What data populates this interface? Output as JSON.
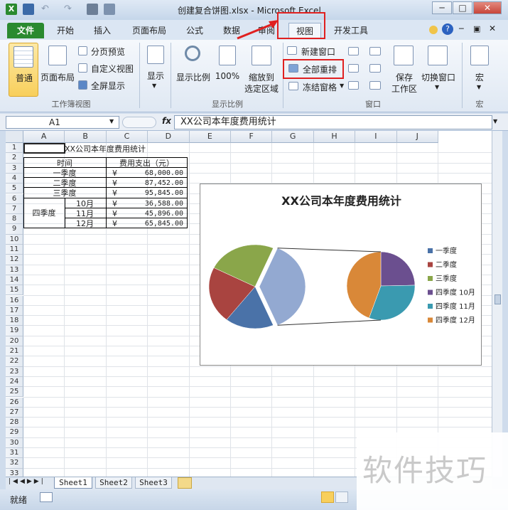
{
  "window": {
    "title": "创建复合饼图.xlsx - Microsoft Excel",
    "controls": [
      "─",
      "□",
      "✕"
    ]
  },
  "tabs": [
    "文件",
    "开始",
    "插入",
    "页面布局",
    "公式",
    "数据",
    "审阅",
    "视图",
    "开发工具"
  ],
  "ribbon": {
    "group_workbook_views": {
      "label": "工作簿视图",
      "normal": "普通",
      "page_layout": "页面布局",
      "page_break": "分页预览",
      "custom_views": "自定义视图",
      "full_screen": "全屏显示"
    },
    "show": "显示",
    "group_zoom": {
      "label": "显示比例",
      "zoom": "显示比例",
      "zoom100": "100%",
      "zoom_to_selection_1": "缩放到",
      "zoom_to_selection_2": "选定区域"
    },
    "group_window": {
      "label": "窗口",
      "new_window": "新建窗口",
      "arrange_all": "全部重排",
      "freeze_panes": "冻结窗格",
      "save_workspace_1": "保存",
      "save_workspace_2": "工作区",
      "switch_windows": "切换窗口"
    },
    "group_macros": {
      "label": "宏",
      "macros": "宏"
    }
  },
  "formula_bar": {
    "name_box": "A1",
    "fx": "fx",
    "content": "XX公司本年度费用统计"
  },
  "columns": [
    "A",
    "B",
    "C",
    "D",
    "E",
    "F",
    "G",
    "H",
    "I",
    "J"
  ],
  "rows": [
    "1",
    "2",
    "3",
    "4",
    "5",
    "6",
    "7",
    "8",
    "9",
    "10",
    "11",
    "12",
    "13",
    "14",
    "15",
    "16",
    "17",
    "18",
    "19",
    "20",
    "21",
    "22",
    "23",
    "24",
    "25",
    "26",
    "27",
    "28",
    "29",
    "30",
    "31",
    "32",
    "33"
  ],
  "table": {
    "title": "XX公司本年度费用统计",
    "header_time": "时间",
    "header_cost": "费用支出（元）",
    "q1": "一季度",
    "q1_val": "68,000.00",
    "q2": "二季度",
    "q2_val": "87,452.00",
    "q3": "三季度",
    "q3_val": "95,845.00",
    "q4": "四季度",
    "oct": "10月",
    "oct_val": "36,588.00",
    "nov": "11月",
    "nov_val": "45,896.00",
    "dec": "12月",
    "dec_val": "65,845.00",
    "currency": "¥"
  },
  "chart_data": {
    "type": "pie",
    "subtype": "pie-of-pie",
    "title": "XX公司本年度费用统计",
    "categories": [
      "一季度",
      "二季度",
      "三季度",
      "四季度 10月",
      "四季度 11月",
      "四季度 12月"
    ],
    "values": [
      68000,
      87452,
      95845,
      36588,
      45896,
      65845
    ],
    "colors": [
      "#4a72a8",
      "#a94440",
      "#8aa64a",
      "#6b4f8f",
      "#3a9ab0",
      "#d98838"
    ],
    "other_color": "#93a9d1",
    "secondary_plot_count": 3,
    "legend_position": "right"
  },
  "sheets": [
    "Sheet1",
    "Sheet2",
    "Sheet3"
  ],
  "status": {
    "ready": "就绪"
  },
  "watermark": "软件技巧"
}
